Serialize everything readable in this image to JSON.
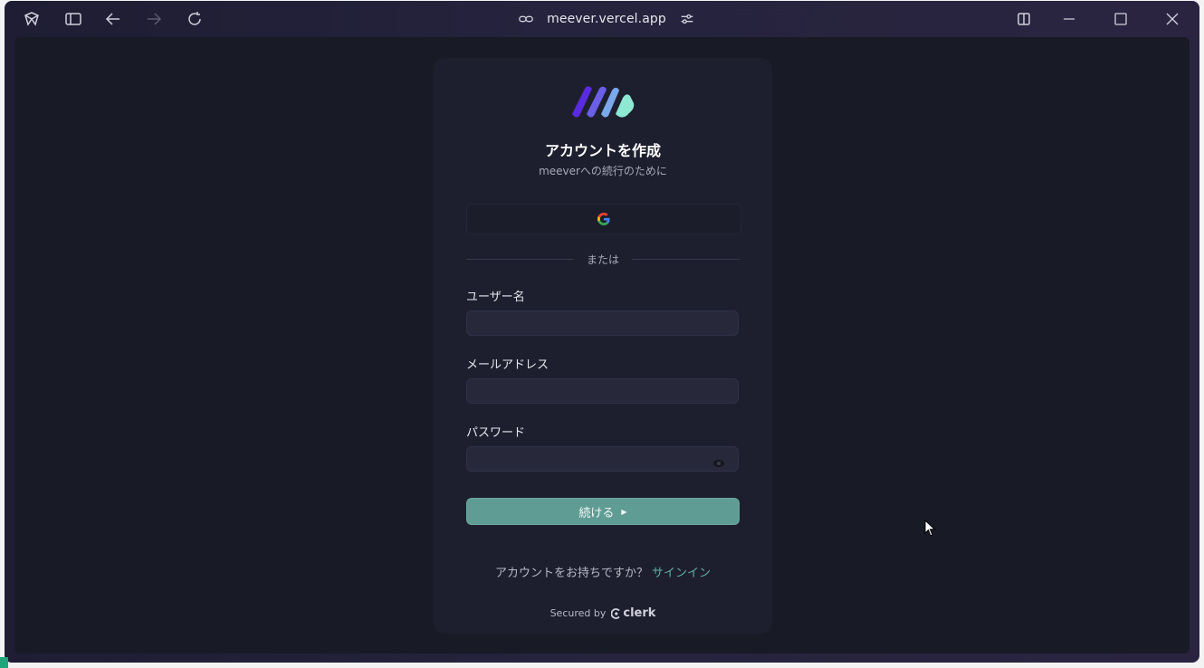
{
  "browser": {
    "url": "meever.vercel.app",
    "icons": {
      "app": "browser-logo-icon",
      "sidebar": "sidebar-toggle-icon",
      "back": "arrow-left-icon",
      "forward": "arrow-right-icon",
      "reload": "reload-icon",
      "link": "link-icon",
      "settings": "sliders-icon",
      "split": "split-view-icon",
      "minimize": "minimize-icon",
      "maximize": "maximize-icon",
      "close": "close-icon"
    }
  },
  "signup": {
    "title": "アカウントを作成",
    "subtitle": "meeverへの続行のために",
    "or_text": "または",
    "username_label": "ユーザー名",
    "email_label": "メールアドレス",
    "password_label": "パスワード",
    "username_value": "",
    "email_value": "",
    "password_value": "",
    "continue_label": "続ける",
    "have_account_text": "アカウントをお持ちですか？",
    "signin_link": "サインイン",
    "secured_by": "Secured by",
    "clerk_brand": "clerk"
  },
  "colors": {
    "accent": "#5f9c94",
    "link": "#5fb0a4",
    "background": "#181a26",
    "card": "#1e1f2e"
  }
}
